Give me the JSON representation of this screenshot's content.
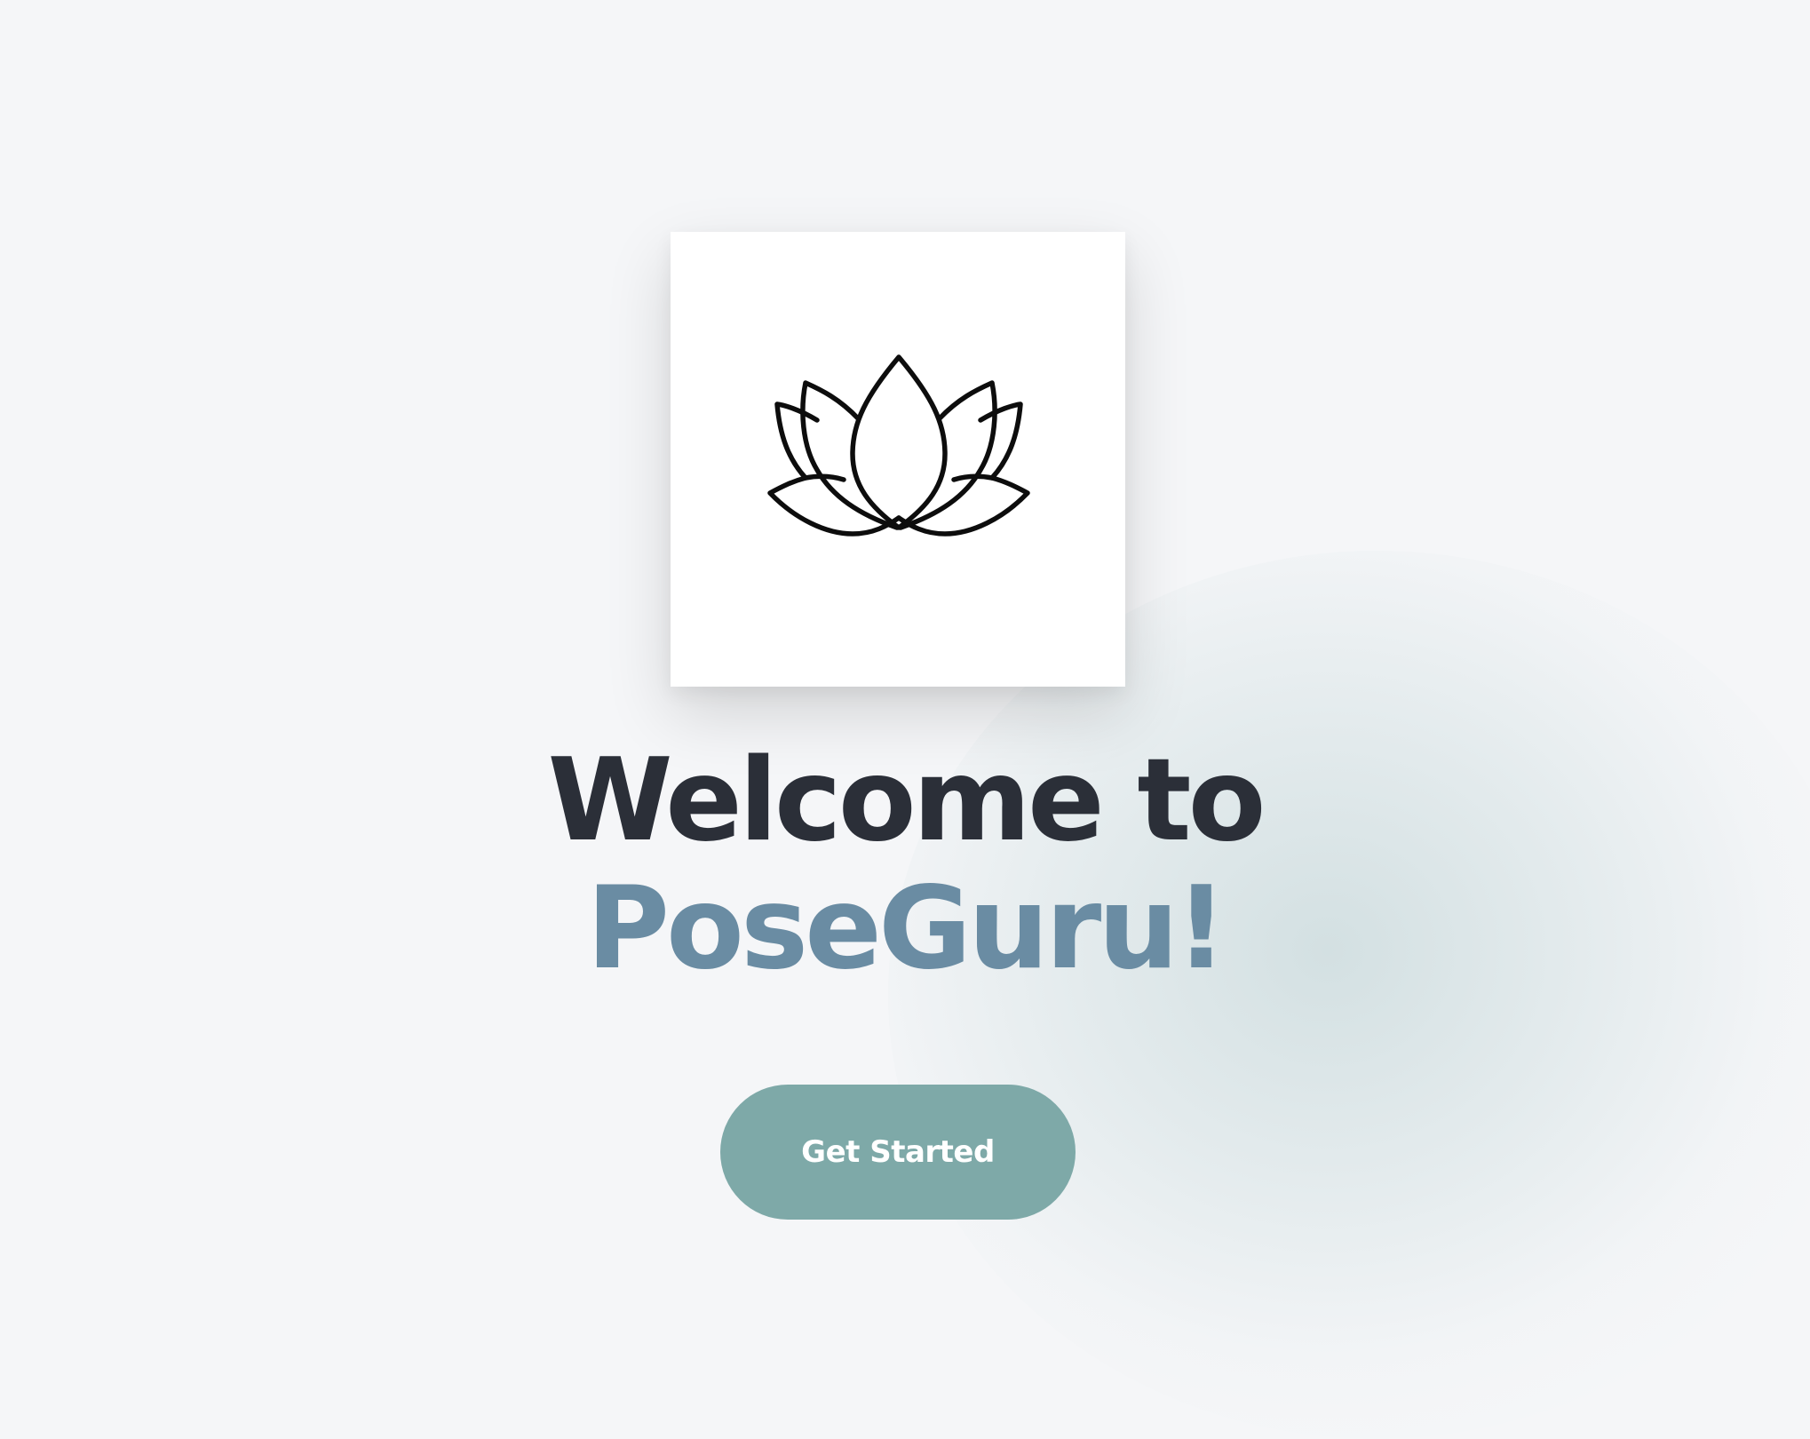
{
  "welcome": {
    "logo_icon": "lotus-icon",
    "headline_line1": "Welcome to",
    "headline_line2": "PoseGuru!",
    "cta_label": "Get Started"
  },
  "colors": {
    "background": "#f5f6f8",
    "heading_dark": "#2b2f38",
    "brand_blue": "#6a8ca3",
    "button_teal": "#7ea9a8",
    "button_text": "#ffffff"
  }
}
